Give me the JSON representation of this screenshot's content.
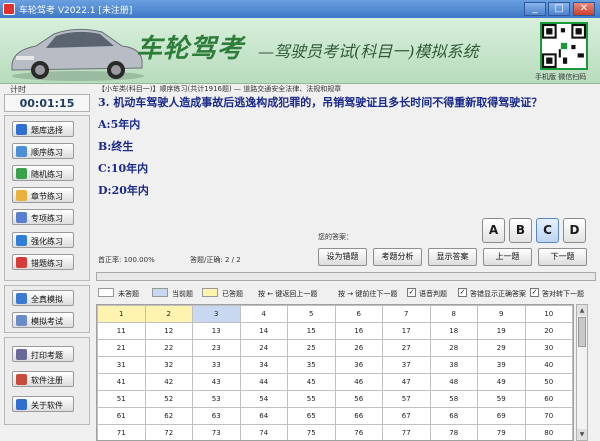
{
  "window": {
    "title": "车轮驾考 V2022.1 [未注册]"
  },
  "banner": {
    "brand": "车轮驾考",
    "subtitle": "—驾驶员考试(科目一)模拟系统",
    "qr_caption": "手机版 微信扫码"
  },
  "sidebar": {
    "timer_label": "计时",
    "timer": "00:01:15",
    "group1": [
      {
        "label": "题库选择",
        "icon": "list-icon",
        "color": "#2f6fcf"
      },
      {
        "label": "顺序练习",
        "icon": "order-icon",
        "color": "#4a8fd8"
      },
      {
        "label": "随机练习",
        "icon": "random-icon",
        "color": "#3aa04a"
      },
      {
        "label": "章节练习",
        "icon": "folder-icon",
        "color": "#e8b23a"
      },
      {
        "label": "专项练习",
        "icon": "check-icon",
        "color": "#5a7fd0"
      },
      {
        "label": "强化练习",
        "icon": "strength-icon",
        "color": "#2f7fd8"
      },
      {
        "label": "错题练习",
        "icon": "flag-icon",
        "color": "#d83a3a"
      }
    ],
    "group2": [
      {
        "label": "全真模拟",
        "icon": "monitor-icon",
        "color": "#3a7ad0"
      },
      {
        "label": "模拟考试",
        "icon": "form-icon",
        "color": "#6a8ac8"
      }
    ],
    "group3": [
      {
        "label": "打印考题",
        "icon": "printer-icon",
        "color": "#6a6a9a"
      },
      {
        "label": "软件注册",
        "icon": "pen-icon",
        "color": "#c84a3a"
      },
      {
        "label": "关于软件",
        "icon": "info-icon",
        "color": "#2f6fcf"
      }
    ]
  },
  "main": {
    "breadcrumb": "【小车类(科目一)】顺序练习(共计1916题) — 道路交通安全法律、法规和规章",
    "question": "3. 机动车驾驶人造成事故后逃逸构成犯罪的，吊销驾驶证且多长时间不得重新取得驾驶证？",
    "options": [
      "A:5年内",
      "B:终生",
      "C:10年内",
      "D:20年内"
    ],
    "answer_label": "您的答案：",
    "answer_letters": [
      "A",
      "B",
      "C",
      "D"
    ],
    "selected_letter": "C",
    "accuracy": "首正率: 100.00%",
    "progress_count": "答题/正确: 2 / 2",
    "actions": [
      "设为错题",
      "考题分析",
      "显示答案",
      "上一题",
      "下一题"
    ],
    "progress_fraction": 0,
    "legend": {
      "unanswered": "未答题",
      "current": "当前题",
      "answered": "已答题",
      "prev_hint": "按 ← 键返回上一题",
      "next_hint": "按 → 键前往下一题",
      "voice": "语音判题",
      "show_wrong": "答错显示正确答案",
      "auto_next": "答对转下一题"
    },
    "legend_colors": {
      "unanswered": "#ffffff",
      "current": "#c8d8f0",
      "answered": "#fff3b0"
    },
    "grid_rows": [
      [
        "1",
        "2",
        "3",
        "4",
        "5",
        "6",
        "7",
        "8",
        "9",
        "10"
      ],
      [
        "11",
        "12",
        "13",
        "14",
        "15",
        "16",
        "17",
        "18",
        "19",
        "20"
      ],
      [
        "21",
        "22",
        "23",
        "24",
        "25",
        "26",
        "27",
        "28",
        "29",
        "30"
      ],
      [
        "31",
        "32",
        "33",
        "34",
        "35",
        "36",
        "37",
        "38",
        "39",
        "40"
      ],
      [
        "41",
        "42",
        "43",
        "44",
        "45",
        "46",
        "47",
        "48",
        "49",
        "50"
      ],
      [
        "51",
        "52",
        "53",
        "54",
        "55",
        "56",
        "57",
        "58",
        "59",
        "60"
      ],
      [
        "61",
        "62",
        "63",
        "64",
        "65",
        "66",
        "67",
        "68",
        "69",
        "70"
      ],
      [
        "71",
        "72",
        "73",
        "74",
        "75",
        "76",
        "77",
        "78",
        "79",
        "80"
      ]
    ]
  }
}
